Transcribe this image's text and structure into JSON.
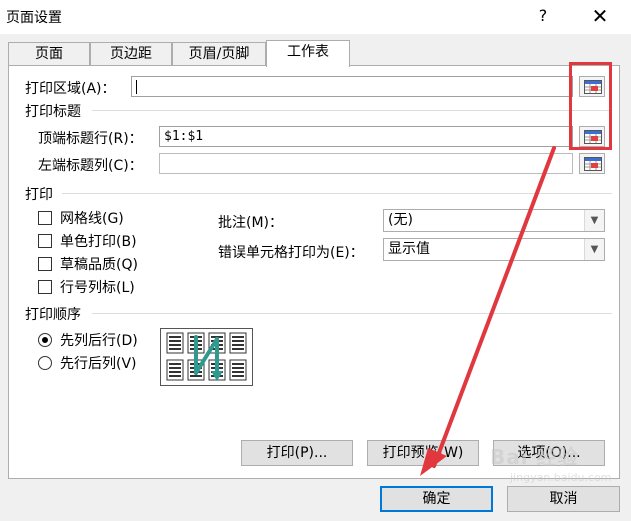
{
  "dialog": {
    "title": "页面设置",
    "help_label": "?",
    "close_label": "✕"
  },
  "tabs": [
    {
      "label": "页面",
      "active": false
    },
    {
      "label": "页边距",
      "active": false
    },
    {
      "label": "页眉/页脚",
      "active": false
    },
    {
      "label": "工作表",
      "active": true
    }
  ],
  "print_area": {
    "label": "打印区域(A)：",
    "value": ""
  },
  "print_titles": {
    "section_label": "打印标题",
    "top_rows_label": "顶端标题行(R)：",
    "top_rows_value": "$1:$1",
    "left_cols_label": "左端标题列(C)：",
    "left_cols_value": ""
  },
  "print": {
    "section_label": "打印",
    "gridlines_label": "网格线(G)",
    "gridlines_checked": false,
    "bw_label": "单色打印(B)",
    "bw_checked": false,
    "draft_label": "草稿品质(Q)",
    "draft_checked": false,
    "headings_label": "行号列标(L)",
    "headings_checked": false,
    "comments_label": "批注(M)：",
    "comments_value": "(无)",
    "errors_label": "错误单元格打印为(E)：",
    "errors_value": "显示值"
  },
  "page_order": {
    "section_label": "打印顺序",
    "down_then_over_label": "先列后行(D)",
    "down_then_over_selected": true,
    "over_then_down_label": "先行后列(V)",
    "over_then_down_selected": false
  },
  "panel_buttons": {
    "print_label": "打印(P)...",
    "preview_label": "打印预览(W)",
    "options_label": "选项(O)..."
  },
  "footer_buttons": {
    "ok_label": "确定",
    "cancel_label": "取消"
  },
  "watermark": {
    "main": "Bai 经验",
    "sub": "jingyan.baidu.com"
  },
  "colors": {
    "annotation_red": "#e0383e",
    "default_button_border": "#0078d7",
    "order_arrow_teal": "#2f9a8f"
  },
  "icons": {
    "collapse_dialog": "range-selector-icon",
    "dropdown": "chevron-down-icon"
  }
}
